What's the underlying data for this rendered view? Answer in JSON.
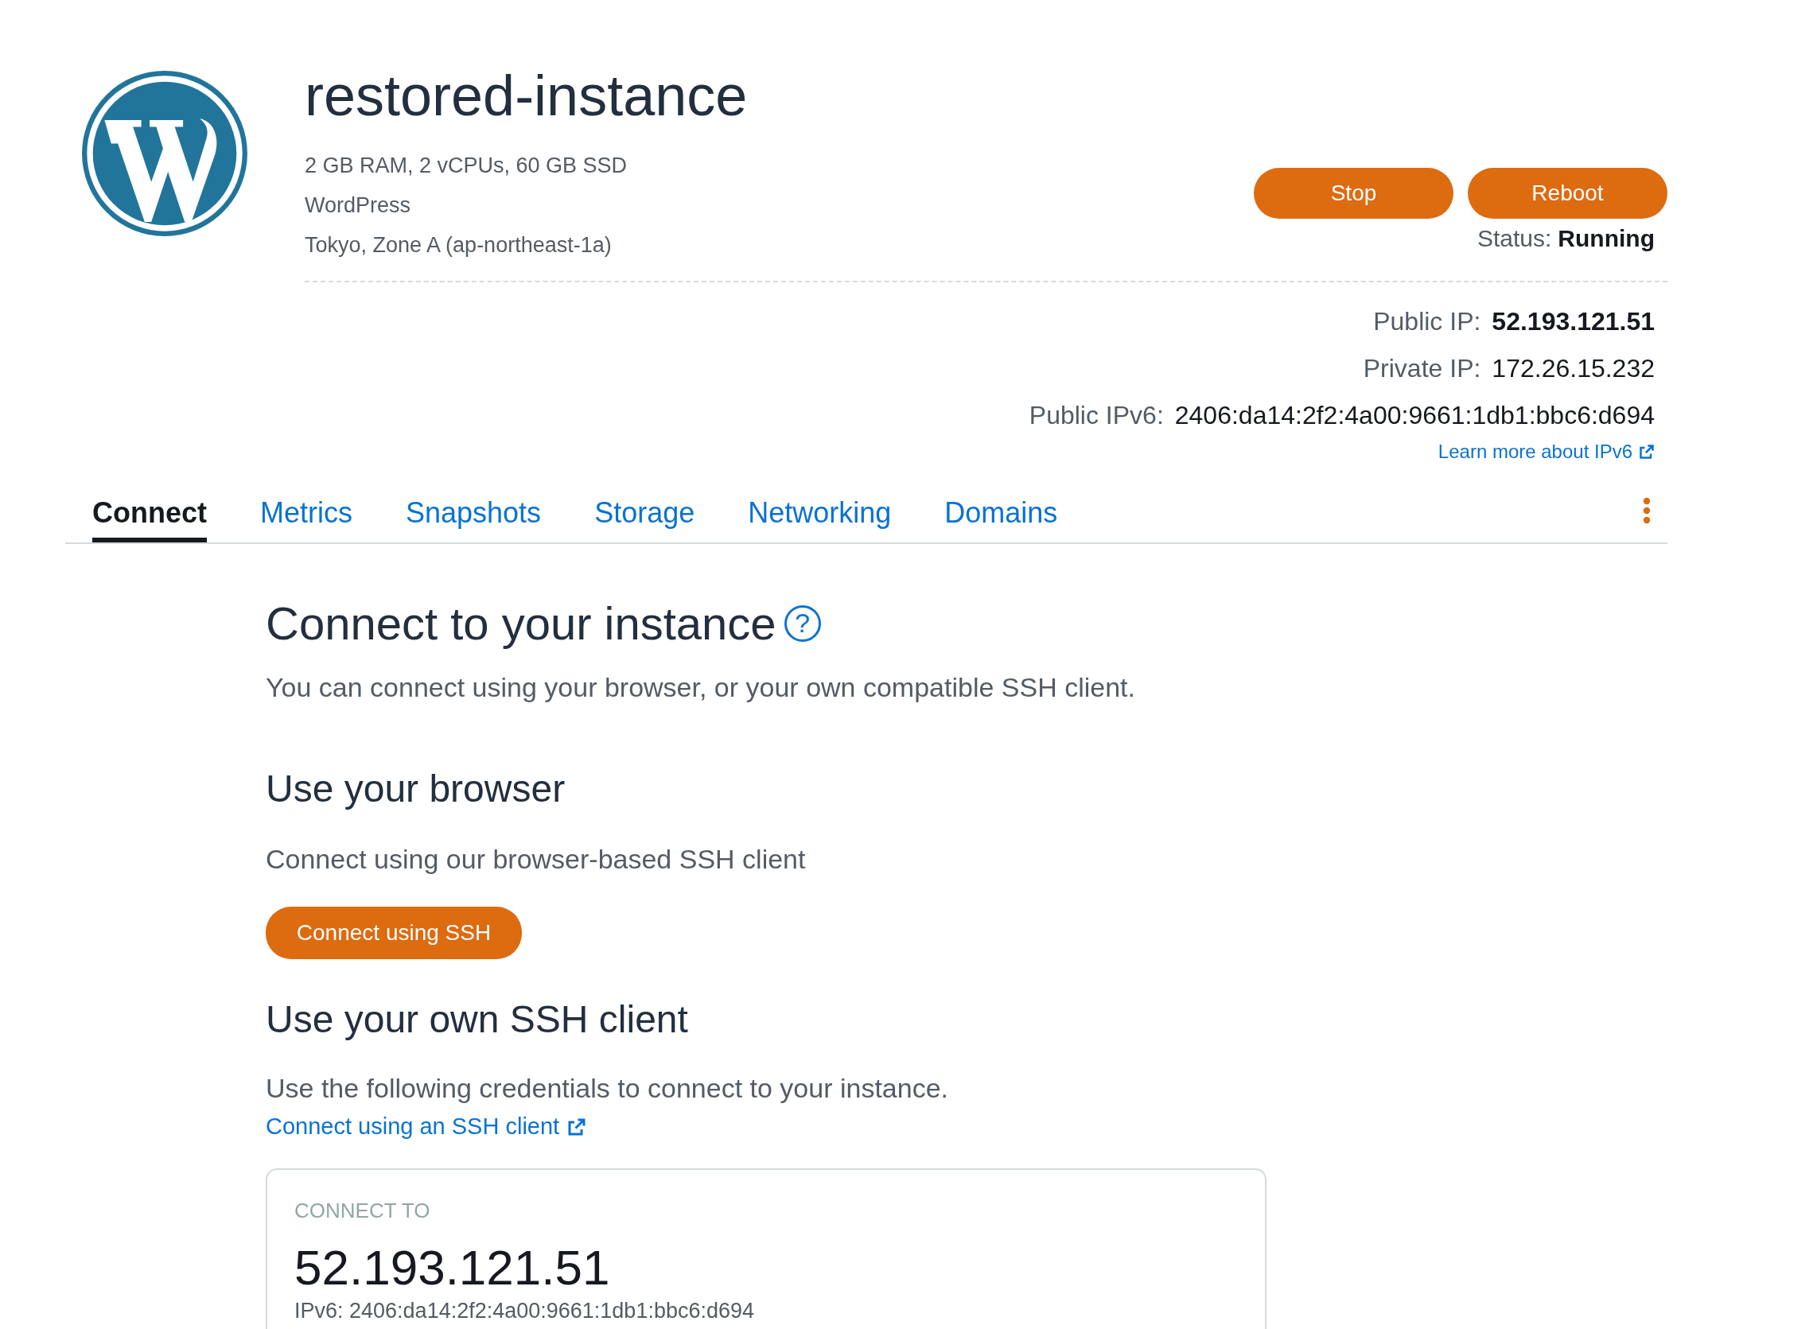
{
  "instance": {
    "name": "restored-instance",
    "specs": [
      "2 GB RAM, 2 vCPUs, 60 GB SSD",
      "WordPress",
      "Tokyo, Zone A (ap-northeast-1a)"
    ]
  },
  "actions": [
    {
      "label": "Stop"
    },
    {
      "label": "Reboot"
    }
  ],
  "status": {
    "label": "Status:",
    "value": "Running"
  },
  "addresses": [
    {
      "label": "Public IP:",
      "value": "52.193.121.51",
      "kind": "primary"
    },
    {
      "label": "Private IP:",
      "value": "172.26.15.232",
      "kind": "plain"
    },
    {
      "label": "Public IPv6:",
      "value": "2406:da14:2f2:4a00:9661:1db1:bbc6:d694",
      "kind": "plain"
    }
  ],
  "ipv6_link": {
    "label": "Learn more about IPv6",
    "external": true
  },
  "tabs": [
    {
      "label": "Connect",
      "selected": true
    },
    {
      "label": "Metrics",
      "selected": false
    },
    {
      "label": "Snapshots",
      "selected": false
    },
    {
      "label": "Storage",
      "selected": false
    },
    {
      "label": "Networking",
      "selected": false
    },
    {
      "label": "Domains",
      "selected": false
    }
  ],
  "connect": {
    "heading": "Connect to your instance",
    "help": "?",
    "intro": "You can connect using your browser, or your own compatible SSH client.",
    "browser": {
      "heading": "Use your browser",
      "text": "Connect using our browser-based SSH client",
      "button": "Connect using SSH"
    },
    "ssh_client": {
      "heading": "Use your own SSH client",
      "text": "Use the following credentials to connect to your instance.",
      "link": {
        "label": "Connect using an SSH client",
        "external": true
      }
    },
    "card": {
      "label": "CONNECT TO",
      "address": "52.193.121.51",
      "ipv6": "IPv6: 2406:da14:2f2:4a00:9661:1db1:bbc6:d694"
    }
  }
}
